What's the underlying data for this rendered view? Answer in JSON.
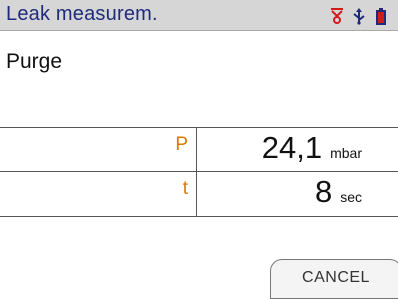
{
  "titlebar": {
    "title": "Leak measurem.",
    "icons": [
      "pump-icon",
      "usb-icon",
      "battery-icon"
    ]
  },
  "subtitle": "Purge",
  "measurements": [
    {
      "label": "P",
      "value": "24,1",
      "unit": "mbar"
    },
    {
      "label": "t",
      "value": "8",
      "unit": "sec"
    }
  ],
  "buttons": {
    "cancel_label": "CANCEL"
  },
  "colors": {
    "title": "#1e2a7d",
    "label_accent": "#e07800",
    "titlebar_bg": "#d6d6d6",
    "icon_red": "#d11a1a",
    "icon_blue": "#1e2a7d"
  }
}
